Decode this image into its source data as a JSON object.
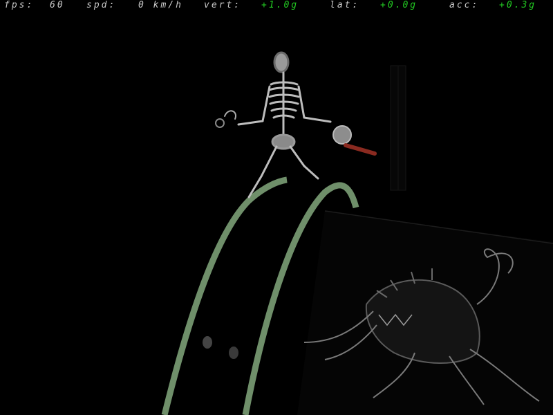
{
  "hud": {
    "fps": {
      "label": "fps:",
      "value": "60"
    },
    "spd": {
      "label": "spd:",
      "value": "0 km/h"
    },
    "vert": {
      "label": "vert:",
      "value": "+1.0g"
    },
    "lat": {
      "label": "lat:",
      "value": "+0.0g"
    },
    "acc": {
      "label": "acc:",
      "value": "+0.3g"
    }
  },
  "colors": {
    "hud_text": "#c8c8c8",
    "g_value": "#22cc22",
    "track": "#6f8f6a",
    "background": "#000000"
  }
}
